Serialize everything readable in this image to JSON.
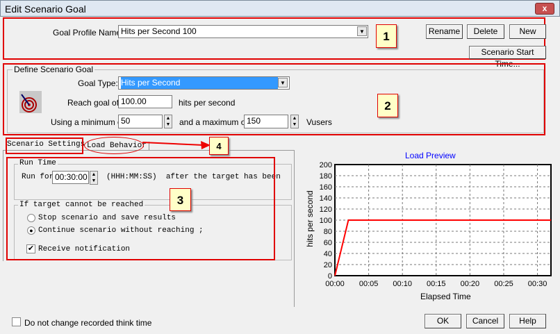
{
  "window": {
    "title": "Edit Scenario Goal",
    "close": "x"
  },
  "profile": {
    "label": "Goal Profile Name:",
    "value": "Hits per Second 100",
    "rename": "Rename",
    "delete": "Delete",
    "new": "New",
    "start_time": "Scenario Start Time..."
  },
  "goal": {
    "group": "Define Scenario Goal",
    "type_label": "Goal Type:",
    "type_value": "Hits per Second",
    "reach_label": "Reach goal of",
    "reach_value": "100.00",
    "reach_unit": "hits per second",
    "min_label": "Using a minimum of",
    "min_value": "50",
    "max_label": "and a maximum of",
    "max_value": "150",
    "max_unit": "Vusers"
  },
  "tabs": [
    {
      "label": "Scenario Settings",
      "active": true
    },
    {
      "label": "Load Behavior",
      "active": false
    }
  ],
  "settings": {
    "run_group": "Run Time",
    "run_for": "Run for",
    "run_value": "00:30:00",
    "run_format": "(HHH:MM:SS)  after the target has been",
    "fail_group": "If target cannot be reached",
    "opt_stop": "Stop scenario and save results",
    "opt_continue": "Continue scenario without reaching ;",
    "selected": "continue",
    "notify": "Receive notification",
    "notify_checked": true
  },
  "annotations": [
    "1",
    "2",
    "3",
    "4"
  ],
  "footer": {
    "think_time": "Do not change recorded think time",
    "think_checked": false,
    "ok": "OK",
    "cancel": "Cancel",
    "help": "Help"
  },
  "colors": {
    "annotation": "#e00000",
    "selection": "#3399ff",
    "series": "#ff0000",
    "chart_title": "#0000ff"
  },
  "chart_data": {
    "type": "line",
    "title": "Load Preview",
    "xlabel": "Elapsed Time",
    "ylabel": "hits per second",
    "xlim": [
      0,
      32
    ],
    "ylim": [
      0,
      200
    ],
    "x_ticks": [
      "00:00",
      "00:05",
      "00:10",
      "00:15",
      "00:20",
      "00:25",
      "00:30"
    ],
    "y_ticks": [
      0,
      20,
      40,
      60,
      80,
      100,
      120,
      140,
      160,
      180,
      200
    ],
    "grid": true,
    "series": [
      {
        "x": [
          0,
          2,
          32
        ],
        "y": [
          0,
          100,
          100
        ]
      }
    ]
  }
}
